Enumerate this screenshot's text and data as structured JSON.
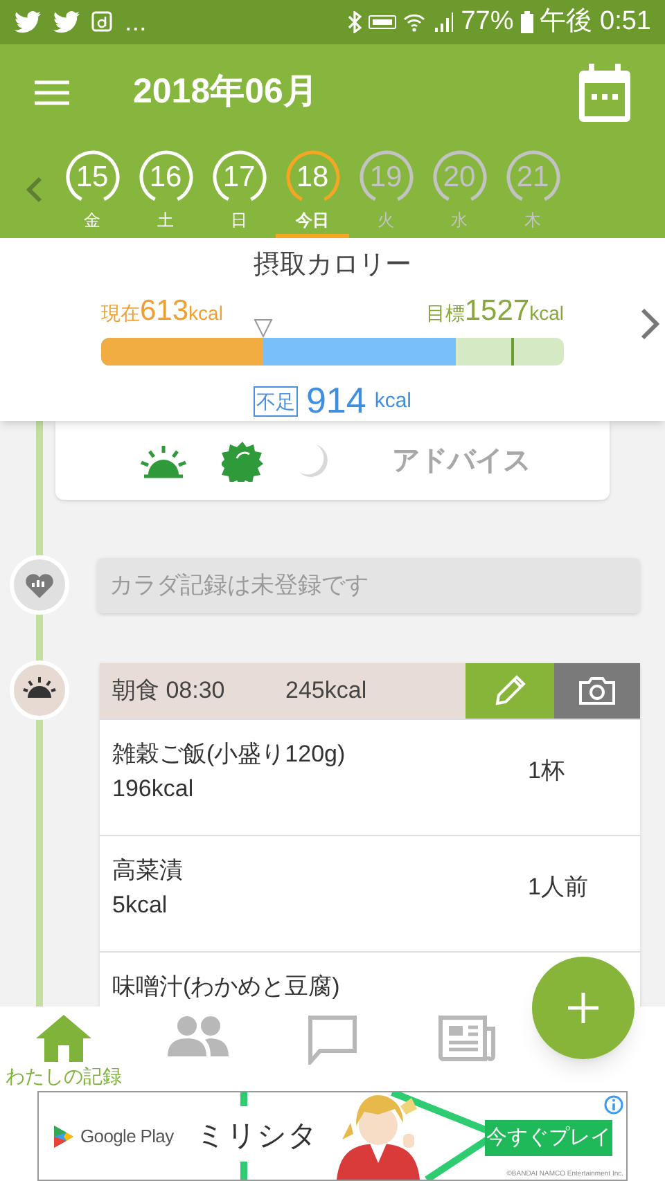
{
  "status_bar": {
    "notifications": "...",
    "battery": "77%",
    "time": "午後 0:51"
  },
  "header": {
    "title": "2018年06月"
  },
  "days": [
    {
      "date": "15",
      "weekday": "金",
      "kind": "past",
      "selected": false
    },
    {
      "date": "16",
      "weekday": "土",
      "kind": "past",
      "selected": false
    },
    {
      "date": "17",
      "weekday": "日",
      "kind": "past",
      "selected": false
    },
    {
      "date": "18",
      "weekday": "今日",
      "kind": "today",
      "selected": true
    },
    {
      "date": "19",
      "weekday": "火",
      "kind": "future",
      "selected": false
    },
    {
      "date": "20",
      "weekday": "水",
      "kind": "future",
      "selected": false
    },
    {
      "date": "21",
      "weekday": "木",
      "kind": "future",
      "selected": false
    }
  ],
  "calories": {
    "title": "摂取カロリー",
    "current_label": "現在",
    "current_value": "613",
    "current_unit": "kcal",
    "target_label": "目標",
    "target_value": "1527",
    "target_unit": "kcal",
    "intake_bar": {
      "level": 0.35
    },
    "remaining_bar": {
      "level": 0.766
    },
    "target_marker": {
      "level": 0.886
    },
    "shortfall_label": "不足",
    "shortfall_value": "914",
    "shortfall_unit": "kcal"
  },
  "advice": {
    "label": "アドバイス",
    "times": [
      {
        "kind": "morning",
        "done": true
      },
      {
        "kind": "noon",
        "done": true
      },
      {
        "kind": "night",
        "done": false
      }
    ]
  },
  "body_record": {
    "text": "カラダ記録は未登録です"
  },
  "meal": {
    "title": "朝食 08:30",
    "total": "245kcal",
    "items": [
      {
        "name": "雑穀ご飯(小盛り120g)",
        "calories": "196kcal",
        "quantity": "1杯"
      },
      {
        "name": "高菜漬",
        "calories": "5kcal",
        "quantity": "1人前"
      },
      {
        "name": "味噌汁(わかめと豆腐)"
      }
    ]
  },
  "nav": [
    {
      "kind": "home",
      "label": "わたしの記録",
      "selected": true
    },
    {
      "kind": "friends",
      "selected": false
    },
    {
      "kind": "chat",
      "selected": false
    },
    {
      "kind": "news",
      "selected": false
    }
  ],
  "ad": {
    "store": "Google Play",
    "title": "ミリシタ",
    "button": "今すぐプレイ",
    "copyright": "©BANDAI NAMCO Entertainment Inc."
  }
}
